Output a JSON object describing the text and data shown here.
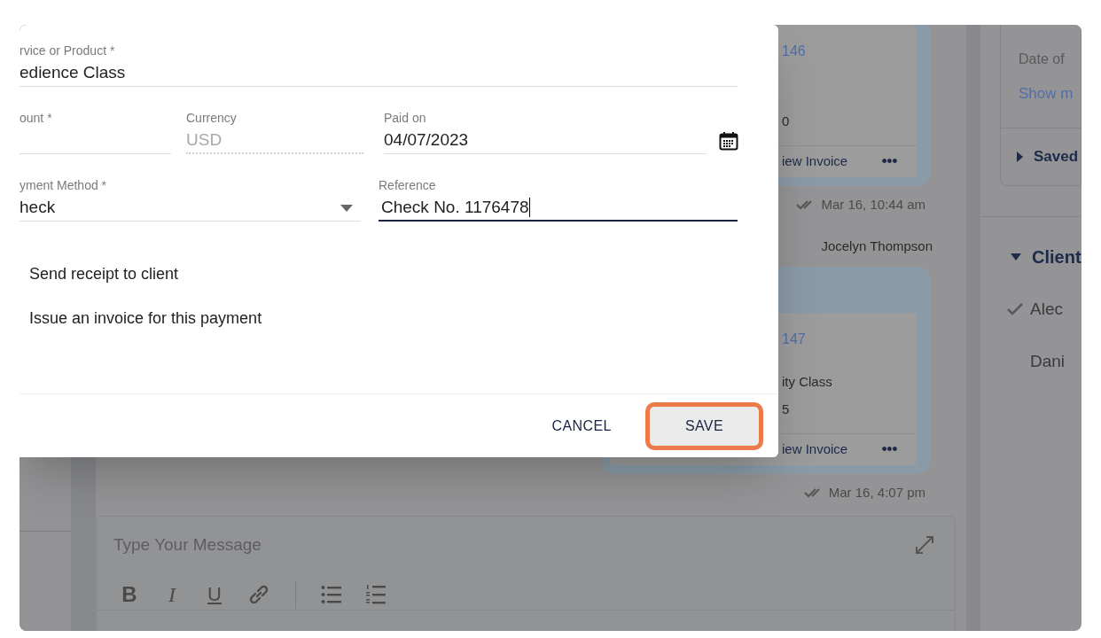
{
  "dialog": {
    "fields": [
      {
        "kind": "text",
        "label": "rvice or Product *",
        "value": "edience Class",
        "focused": false
      },
      {
        "kind": "text",
        "label": "ount *",
        "focused": false
      },
      {
        "kind": "readonly",
        "label": "Currency",
        "value": "USD",
        "focused": false
      },
      {
        "kind": "date",
        "label": "Paid on",
        "value": "04/07/2023",
        "focused": false
      },
      {
        "kind": "select",
        "label": "yment Method *",
        "value": "heck",
        "focused": false
      },
      {
        "kind": "text",
        "label": "Reference",
        "value": "Check No. 1176478",
        "focused": true
      }
    ],
    "options": [
      "Send receipt to client",
      "Issue an invoice for this payment"
    ],
    "buttons": [
      {
        "kind": "text",
        "label": "CANCEL"
      },
      {
        "kind": "highlighted",
        "label": "SAVE"
      }
    ]
  },
  "messages": [
    {
      "kind": "invoice",
      "number": "146",
      "lines": [
        "0"
      ],
      "action": "iew Invoice",
      "more": "•••",
      "time": "Mar 16, 10:44 am"
    },
    {
      "kind": "sender",
      "name": "Jocelyn Thompson"
    },
    {
      "kind": "invoice",
      "number": "147",
      "lines": [
        "ity Class",
        "5"
      ],
      "action": "iew Invoice",
      "more": "•••",
      "time": "Mar 16, 4:07 pm"
    }
  ],
  "composer": {
    "placeholder": "Type Your Message",
    "toolbar": [
      {
        "kind": "bold",
        "label": "B"
      },
      {
        "kind": "italic",
        "label": "I"
      },
      {
        "kind": "underline",
        "label": "U"
      },
      {
        "kind": "link"
      },
      {
        "kind": "divider"
      },
      {
        "kind": "bullets"
      },
      {
        "kind": "numbers"
      }
    ]
  },
  "side": {
    "details": {
      "label": "Date of",
      "link": "Show m"
    },
    "sections": [
      {
        "title": "Saved",
        "expanded": false
      },
      {
        "title": "Client",
        "expanded": true,
        "items": [
          {
            "name": "Alec",
            "checked": true
          },
          {
            "name": "Dani",
            "checked": false
          }
        ]
      }
    ]
  }
}
